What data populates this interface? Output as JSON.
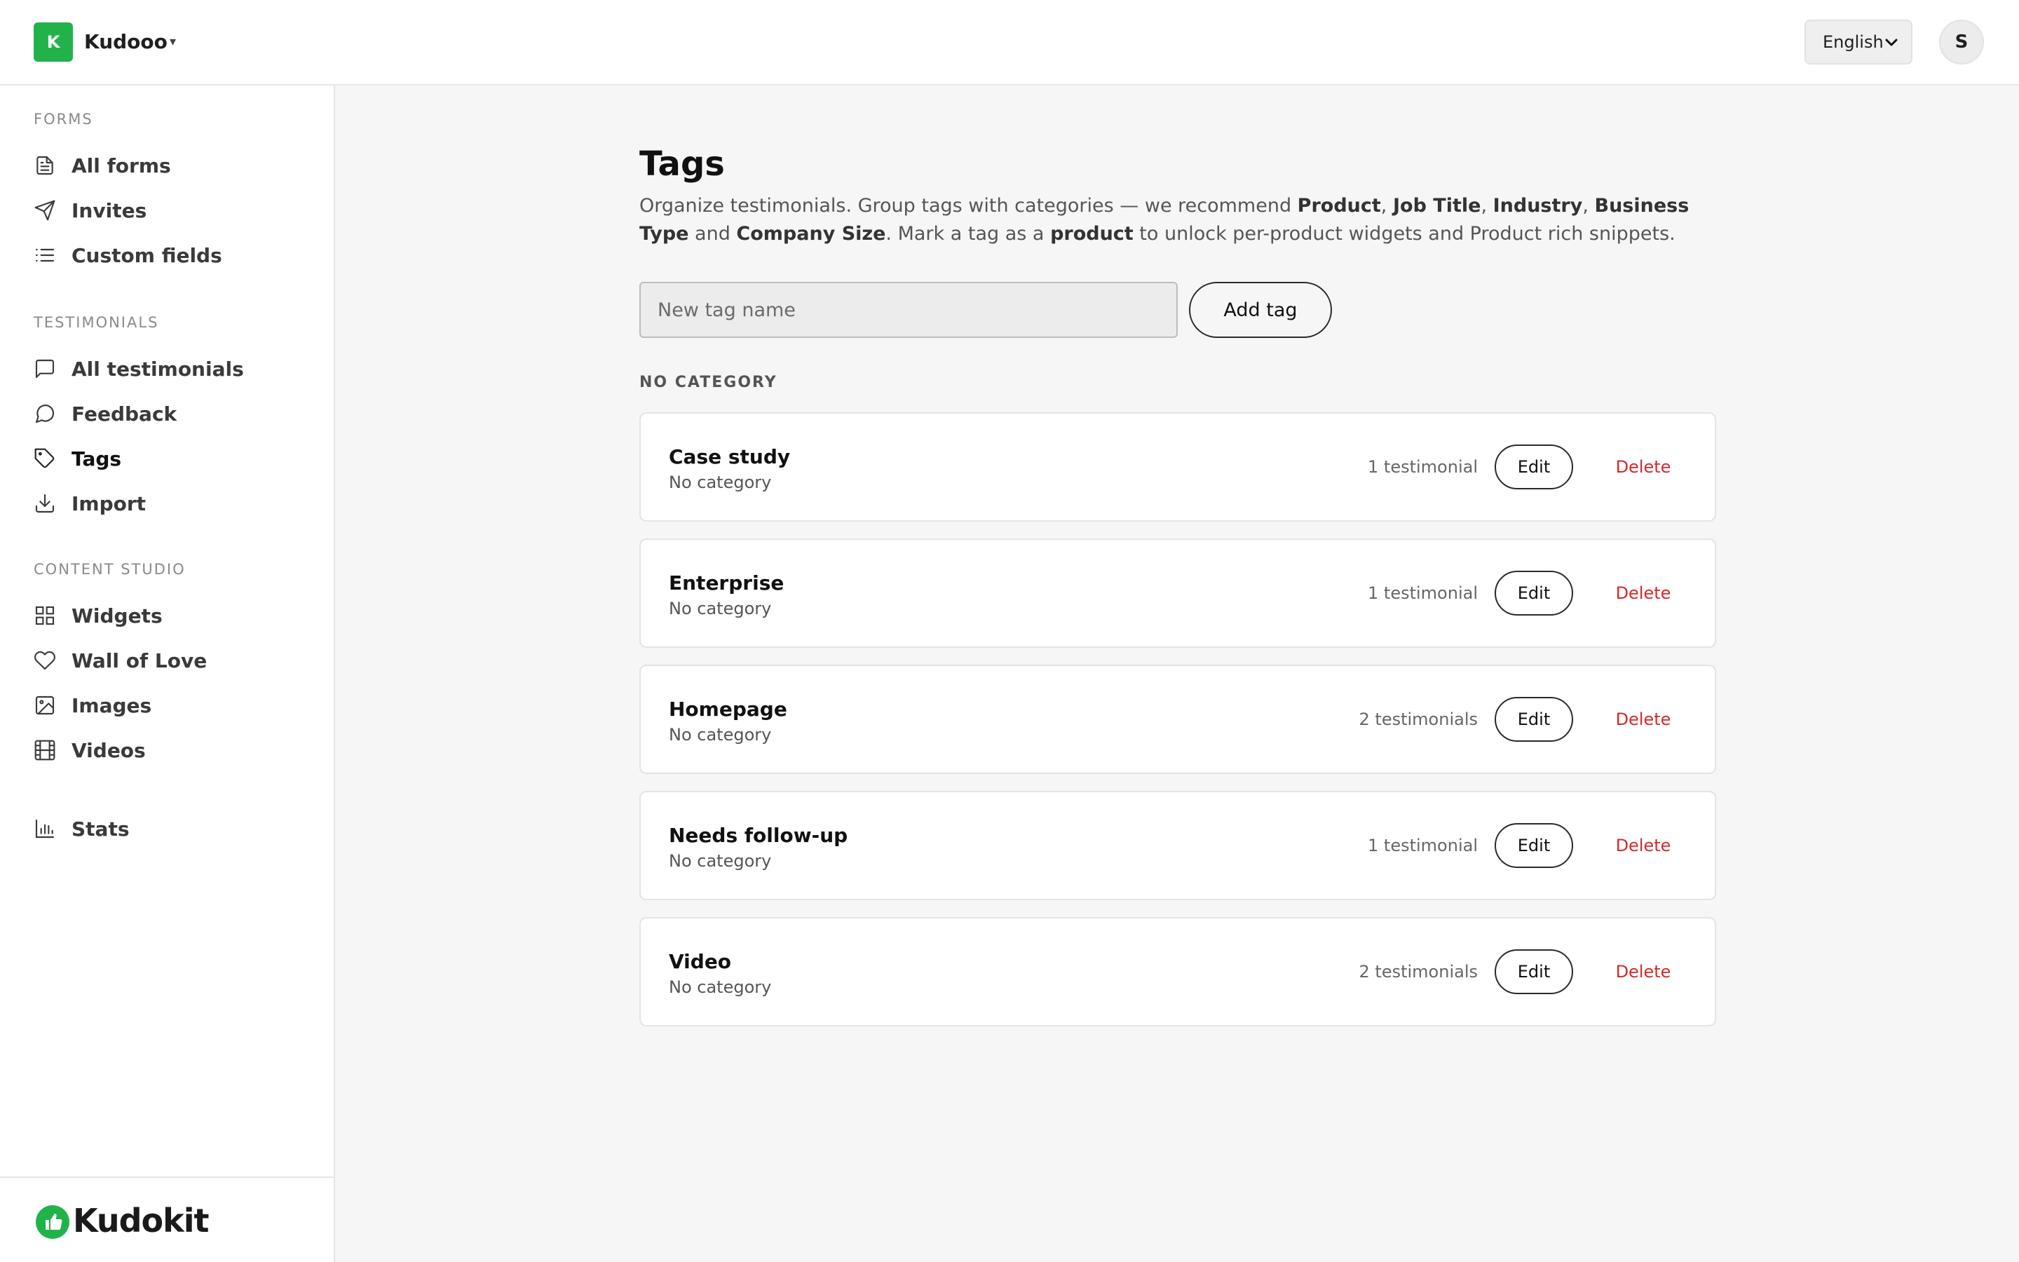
{
  "header": {
    "workspace_initial": "K",
    "workspace_name": "Kudooo",
    "workspace_caret": "▾",
    "language": "English",
    "avatar_initial": "S"
  },
  "sidebar": {
    "sections": [
      {
        "label": "FORMS",
        "items": [
          {
            "label": "All forms",
            "icon": "document-icon"
          },
          {
            "label": "Invites",
            "icon": "send-icon"
          },
          {
            "label": "Custom fields",
            "icon": "list-icon"
          }
        ]
      },
      {
        "label": "TESTIMONIALS",
        "items": [
          {
            "label": "All testimonials",
            "icon": "message-square-icon"
          },
          {
            "label": "Feedback",
            "icon": "message-circle-icon"
          },
          {
            "label": "Tags",
            "icon": "tag-icon",
            "active": true
          },
          {
            "label": "Import",
            "icon": "download-icon"
          }
        ]
      },
      {
        "label": "CONTENT STUDIO",
        "items": [
          {
            "label": "Widgets",
            "icon": "grid-icon"
          },
          {
            "label": "Wall of Love",
            "icon": "heart-icon"
          },
          {
            "label": "Images",
            "icon": "image-icon"
          },
          {
            "label": "Videos",
            "icon": "film-icon"
          }
        ]
      },
      {
        "label": "",
        "items": [
          {
            "label": "Stats",
            "icon": "bar-chart-icon"
          }
        ]
      }
    ],
    "brand_name": "Kudokit",
    "accent_color": "#21b34a"
  },
  "main": {
    "title": "Tags",
    "description": {
      "t1": "Organize testimonials. Group tags with categories — we recommend ",
      "b1": "Product",
      "t2": ", ",
      "b2": "Job Title",
      "t3": ", ",
      "b3": "Industry",
      "t4": ", ",
      "b4": "Business Type",
      "t5": " and ",
      "b5": "Company Size",
      "t6": ". Mark a tag as a ",
      "b6": "product",
      "t7": " to unlock per-product widgets and Product rich snippets."
    },
    "new_tag_placeholder": "New tag name",
    "add_tag_label": "Add tag",
    "category_heading": "NO CATEGORY",
    "edit_label": "Edit",
    "delete_label": "Delete",
    "delete_color": "#d42a2a",
    "tags": [
      {
        "name": "Case study",
        "category": "No category",
        "count": "1 testimonial"
      },
      {
        "name": "Enterprise",
        "category": "No category",
        "count": "1 testimonial"
      },
      {
        "name": "Homepage",
        "category": "No category",
        "count": "2 testimonials"
      },
      {
        "name": "Needs follow-up",
        "category": "No category",
        "count": "1 testimonial"
      },
      {
        "name": "Video",
        "category": "No category",
        "count": "2 testimonials"
      }
    ]
  }
}
